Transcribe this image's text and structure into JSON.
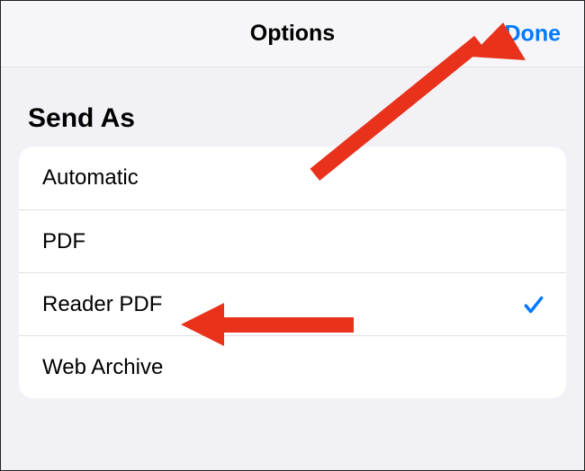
{
  "header": {
    "title": "Options",
    "done_label": "Done"
  },
  "section": {
    "title": "Send As"
  },
  "list": {
    "items": [
      {
        "label": "Automatic",
        "selected": false
      },
      {
        "label": "PDF",
        "selected": false
      },
      {
        "label": "Reader PDF",
        "selected": true
      },
      {
        "label": "Web Archive",
        "selected": false
      }
    ]
  },
  "annotations": {
    "arrow_color": "#e8321b"
  }
}
